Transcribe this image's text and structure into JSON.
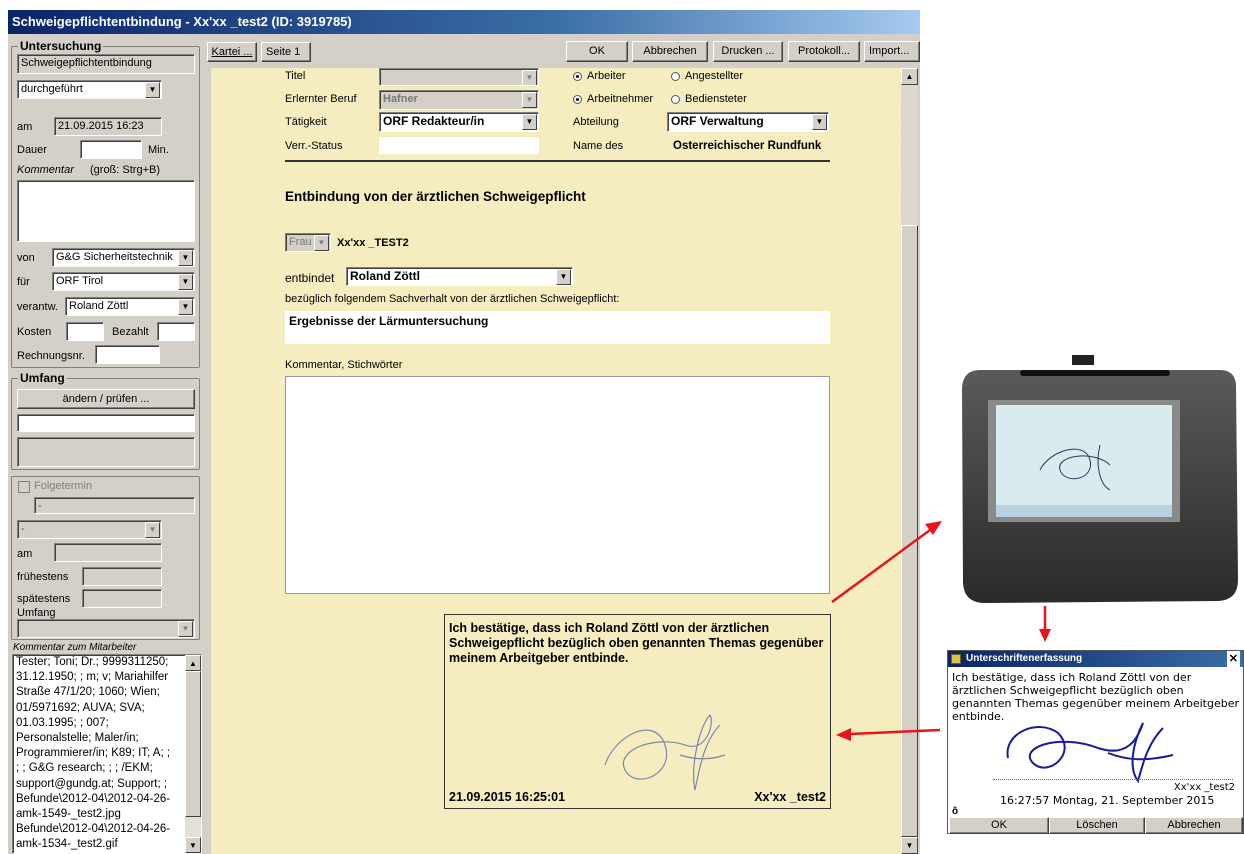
{
  "window": {
    "title": "Schweigepflichtentbindung -  Xx'xx _test2  (ID: 3919785)"
  },
  "left": {
    "untersuchung": {
      "title": "Untersuchung",
      "type": "Schweigepflichtentbindung",
      "status": "durchgeführt",
      "am_label": "am",
      "am_value": "21.09.2015 16:23",
      "dauer_label": "Dauer",
      "dauer_unit": "Min.",
      "kommentar_label": "Kommentar",
      "kommentar_hint": "(groß: Strg+B)",
      "von_label": "von",
      "von_value": "G&G Sicherheitstechnik",
      "fuer_label": "für",
      "fuer_value": "ORF Tirol",
      "verantw_label": "verantw.",
      "verantw_value": "Roland Zöttl",
      "kosten_label": "Kosten",
      "bezahlt_label": "Bezahlt",
      "rechnung_label": "Rechnungsnr."
    },
    "umfang": {
      "title": "Umfang",
      "button": "ändern / prüfen ..."
    },
    "folgetermin": {
      "label": "Folgetermin",
      "field1": "-",
      "field2": "-",
      "am_label": "am",
      "fruehestens_label": "frühestens",
      "spaetestens_label": "spätestens",
      "umfang_label": "Umfang"
    },
    "kommentar_mitarbeiter": {
      "label": "Kommentar zum Mitarbeiter",
      "lines": [
        "Tester; Toni; Dr.; 9999311250;",
        "31.12.1950; ; m; v; Mariahilfer",
        "Straße 47/1/20; 1060; Wien;",
        "01/5971692; AUVA; SVA;",
        "01.03.1995; ; 007;",
        "Personalstelle; Maler/in;",
        "Programmierer/in; K89; IT; A; ;",
        "; ; G&G research; ; ; /EKM;",
        "support@gundg.at; Support; ;",
        " Befunde\\2012-04\\2012-04-26-",
        "amk-1549-_test2.jpg",
        " Befunde\\2012-04\\2012-04-26-",
        "amk-1534-_test2.gif"
      ]
    }
  },
  "toolbar": {
    "tabs": [
      "Kartei ...",
      "Seite 1"
    ],
    "buttons": [
      "OK",
      "Abbrechen",
      "Drucken ...",
      "Protokoll...",
      "Import..."
    ]
  },
  "form": {
    "titel_label": "Titel",
    "beruf_label": "Erlernter Beruf",
    "beruf_value": "Hafner",
    "taetigkeit_label": "Tätigkeit",
    "taetigkeit_value": "ORF Redakteur/in",
    "verr_label": "Verr.-Status",
    "radio1a": "Arbeiter",
    "radio1b": "Angestellter",
    "radio2a": "Arbeitnehmer",
    "radio2b": "Bediensteter",
    "abteilung_label": "Abteilung",
    "abteilung_value": "ORF Verwaltung",
    "name_label": "Name des",
    "name_value": "Österreichischer Rundfunk",
    "heading": "Entbindung von der ärztlichen Schweigepflicht",
    "anrede": "Frau",
    "patient": "Xx'xx _TEST2",
    "entbindet_label": "entbindet",
    "entbindet_value": "Roland Zöttl",
    "bezueglich": "bezüglich folgendem Sachverhalt von der ärztlichen Schweigepflicht:",
    "sachverhalt": "Ergebnisse der Lärmuntersuchung",
    "kommentar_label": "Kommentar, Stichwörter",
    "signature_text": "Ich bestätige, dass ich  Roland Zöttl von der ärztlichen Schweigepflicht bezüglich oben genannten Themas gegenüber meinem Arbeitgeber entbinde.",
    "signature_date": "21.09.2015 16:25:01",
    "signature_name": "Xx'xx _test2"
  },
  "popup": {
    "title": "Unterschriftenerfassung",
    "text": "Ich bestätige, dass ich  Roland Zöttl von der ärztlichen Schweigepflicht bezüglich oben genannten Themas gegenüber meinem Arbeitgeber entbinde.",
    "signer": "Xx'xx _test2",
    "datetime": "16:27:57 Montag, 21. September 2015",
    "buttons": [
      "OK",
      "Löschen",
      "Abbrechen"
    ]
  },
  "colors": {
    "arrow": "#e8141c",
    "form_bg": "#f5edc0",
    "titlebar": "#0a246a"
  }
}
